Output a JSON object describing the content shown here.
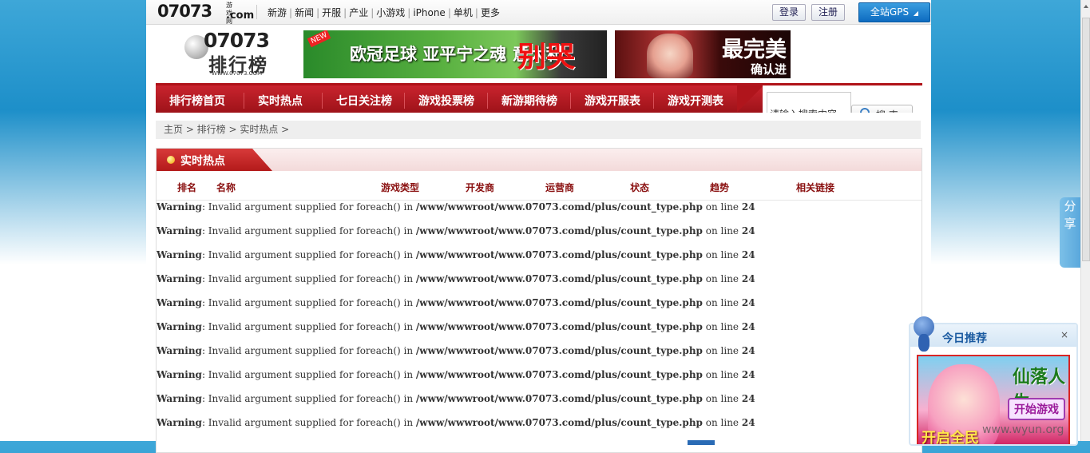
{
  "topbar": {
    "logo_num": "07073",
    "logo_sub": "游戏网",
    "logo_dom": ".com",
    "nav": [
      "新游",
      "新闻",
      "开服",
      "产业",
      "小游戏",
      "iPhone",
      "单机",
      "更多"
    ],
    "login": "登录",
    "register": "注册",
    "gps": "全站GPS"
  },
  "header": {
    "rank_logo_num": "07073",
    "rank_logo_cn": "排行榜",
    "rank_logo_url": "WWW.07073.COM",
    "banner1_tag": "NEW",
    "banner1_text": "欧冠足球  亚平宁之魂 意大利",
    "banner1_big": "别哭",
    "banner2_text": "最完美",
    "banner2_sub": "确认进"
  },
  "mainnav": [
    "排行榜首页",
    "实时热点",
    "七日关注榜",
    "游戏投票榜",
    "新游期待榜",
    "游戏开服表",
    "游戏开测表"
  ],
  "search": {
    "placeholder": "请输入搜索内容",
    "button": "搜 索"
  },
  "breadcrumb": "主页 > 排行榜 > 实时热点 >",
  "section": {
    "title": "实时热点",
    "columns": [
      "排名",
      "名称",
      "游戏类型",
      "开发商",
      "运营商",
      "状态",
      "趋势",
      "相关链接"
    ]
  },
  "warnings": [
    {
      "label": "Warning",
      "msg": ": Invalid argument supplied for foreach() in ",
      "file": "/www/wwwroot/www.07073.comd/plus/count_type.php",
      "on": " on line ",
      "line": "24"
    },
    {
      "label": "Warning",
      "msg": ": Invalid argument supplied for foreach() in ",
      "file": "/www/wwwroot/www.07073.comd/plus/count_type.php",
      "on": " on line ",
      "line": "24"
    },
    {
      "label": "Warning",
      "msg": ": Invalid argument supplied for foreach() in ",
      "file": "/www/wwwroot/www.07073.comd/plus/count_type.php",
      "on": " on line ",
      "line": "24"
    },
    {
      "label": "Warning",
      "msg": ": Invalid argument supplied for foreach() in ",
      "file": "/www/wwwroot/www.07073.comd/plus/count_type.php",
      "on": " on line ",
      "line": "24"
    },
    {
      "label": "Warning",
      "msg": ": Invalid argument supplied for foreach() in ",
      "file": "/www/wwwroot/www.07073.comd/plus/count_type.php",
      "on": " on line ",
      "line": "24"
    },
    {
      "label": "Warning",
      "msg": ": Invalid argument supplied for foreach() in ",
      "file": "/www/wwwroot/www.07073.comd/plus/count_type.php",
      "on": " on line ",
      "line": "24"
    },
    {
      "label": "Warning",
      "msg": ": Invalid argument supplied for foreach() in ",
      "file": "/www/wwwroot/www.07073.comd/plus/count_type.php",
      "on": " on line ",
      "line": "24"
    },
    {
      "label": "Warning",
      "msg": ": Invalid argument supplied for foreach() in ",
      "file": "/www/wwwroot/www.07073.comd/plus/count_type.php",
      "on": " on line ",
      "line": "24"
    },
    {
      "label": "Warning",
      "msg": ": Invalid argument supplied for foreach() in ",
      "file": "/www/wwwroot/www.07073.comd/plus/count_type.php",
      "on": " on line ",
      "line": "24"
    },
    {
      "label": "Warning",
      "msg": ": Invalid argument supplied for foreach() in ",
      "file": "/www/wwwroot/www.07073.comd/plus/count_type.php",
      "on": " on line ",
      "line": "24"
    }
  ],
  "share": [
    "分",
    "享"
  ],
  "today": {
    "title": "今日推荐",
    "close": "×",
    "game_logo": "仙落人生",
    "play": "开始游戏",
    "slogan": "开启全民"
  },
  "watermark": "www.wyun.org",
  "icons": {
    "search": "search-icon",
    "close": "close-icon",
    "gps_arrow": "chevron-down-icon"
  },
  "colors": {
    "accent_red": "#b01218",
    "accent_blue": "#0d6bc0"
  }
}
